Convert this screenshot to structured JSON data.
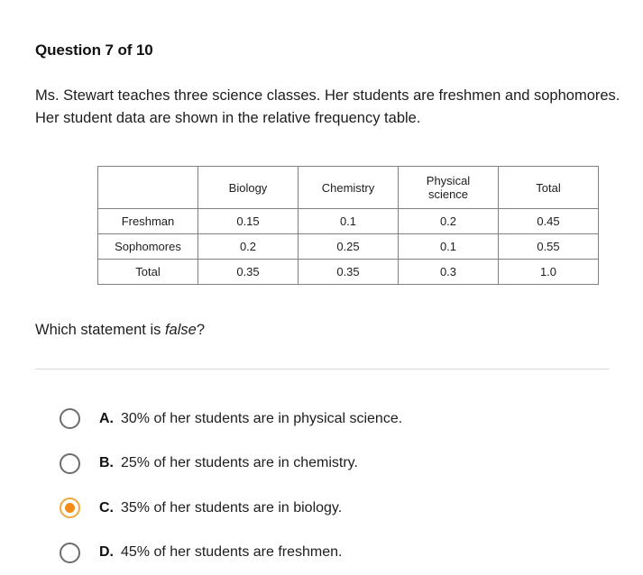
{
  "question": {
    "heading": "Question 7 of 10",
    "prompt": "Ms. Stewart teaches three science classes. Her students are freshmen and sophomores. Her student data are shown in the relative frequency table.",
    "sub_prompt_prefix": "Which statement is ",
    "sub_prompt_italic": "false",
    "sub_prompt_suffix": "?"
  },
  "table": {
    "corner_label": "",
    "columns": [
      "Biology",
      "Chemistry",
      "Physical science",
      "Total"
    ],
    "physical_science_line1": "Physical",
    "physical_science_line2": "science",
    "rows": [
      {
        "label": "Freshman",
        "values": [
          "0.15",
          "0.1",
          "0.2",
          "0.45"
        ]
      },
      {
        "label": "Sophomores",
        "values": [
          "0.2",
          "0.25",
          "0.1",
          "0.55"
        ]
      },
      {
        "label": "Total",
        "values": [
          "0.35",
          "0.35",
          "0.3",
          "1.0"
        ]
      }
    ]
  },
  "options": [
    {
      "letter": "A.",
      "text": "30% of her students are in physical science.",
      "selected": false
    },
    {
      "letter": "B.",
      "text": "25% of her students are in chemistry.",
      "selected": false
    },
    {
      "letter": "C.",
      "text": "35% of her students are in biology.",
      "selected": true
    },
    {
      "letter": "D.",
      "text": "45% of her students are freshmen.",
      "selected": false
    }
  ],
  "colors": {
    "accent_selected": "#f28c18",
    "accent_ring": "#f0a83c",
    "radio_unselected": "#6d6d6d",
    "table_border": "#808080",
    "divider": "#d8d8d8",
    "text": "#1d1d1d",
    "background": "#ffffff"
  }
}
